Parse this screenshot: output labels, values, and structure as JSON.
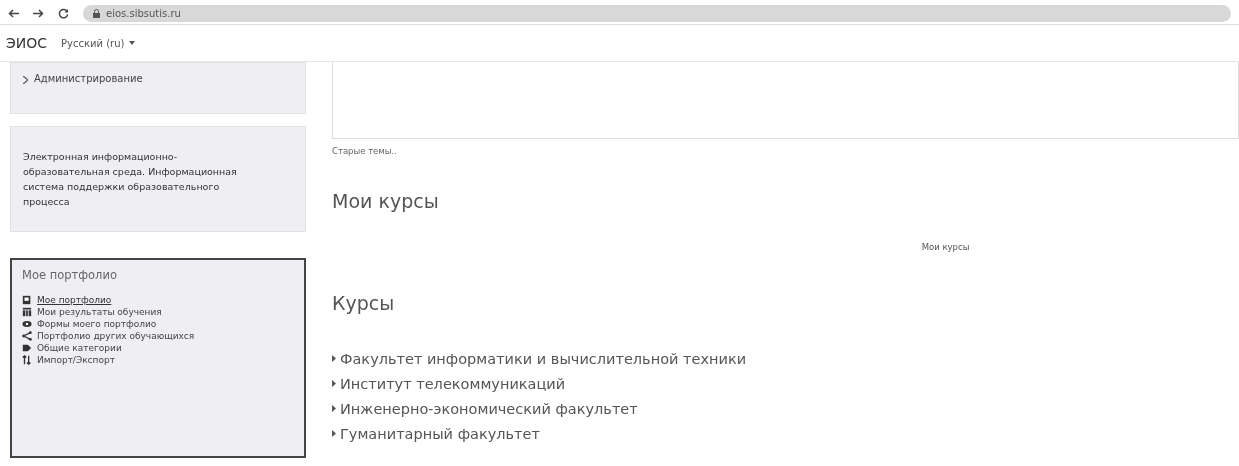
{
  "browser": {
    "url": "eios.sibsutis.ru"
  },
  "header": {
    "brand": "ЭИОС",
    "language": "Русский (ru)"
  },
  "sidebar": {
    "admin": {
      "label": "Администрирование"
    },
    "description": "Электронная информационно-образовательная среда. Информационная система поддержки образовательного процесса",
    "portfolio": {
      "title": "Мое портфолио",
      "items": [
        {
          "label": "Мое портфолио",
          "link": true
        },
        {
          "label": "Мои результаты обучения",
          "link": false
        },
        {
          "label": "Формы моего портфолио",
          "link": false
        },
        {
          "label": "Портфолио других обучающихся",
          "link": false
        },
        {
          "label": "Общие категории",
          "link": false
        },
        {
          "label": "Импорт/Экспорт",
          "link": false
        }
      ]
    }
  },
  "main": {
    "older_topics": "Старые темы..",
    "my_courses": {
      "heading": "Мои курсы",
      "text": "Мои курсы"
    },
    "courses": {
      "heading": "Курсы",
      "categories": [
        {
          "label": "Факультет информатики и вычислительной техники"
        },
        {
          "label": "Институт телекоммуникаций"
        },
        {
          "label": "Инженерно-экономический факультет"
        },
        {
          "label": "Гуманитарный факультет"
        }
      ]
    }
  }
}
